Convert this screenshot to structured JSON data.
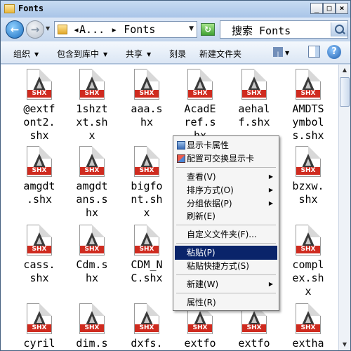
{
  "window": {
    "title": "Fonts",
    "min": "_",
    "max": "□",
    "close": "×"
  },
  "address": {
    "path": "◂A... ▸ Fonts",
    "search": "搜索 Fonts"
  },
  "toolbar": {
    "organize": "组织",
    "include_library": "包含到库中",
    "share": "共享",
    "burn": "刻录",
    "new_folder": "新建文件夹"
  },
  "files": [
    "@extf\nont2.\nshx",
    "1shzt\nxt.sh\nx",
    "aaa.s\nhx",
    "AcadE\nref.s\nhx",
    "aehal\nf.shx",
    "AMDTS\nymbol\ns.shx",
    "amgdt\n.shx",
    "amgdt\nans.s\nhx",
    "bigfo\nnt.sh\nx",
    "",
    "",
    "bzxw.\nshx",
    "cass.\nshx",
    "Cdm.s\nhx",
    "CDM_N\nC.shx",
    "",
    "",
    "compl\nex.sh\nx",
    "cyril",
    "dim.s",
    "dxfs.",
    "extfo",
    "extfo",
    "extha"
  ],
  "file_badge": "SHX",
  "context_menu": {
    "display_props": "显示卡属性",
    "switchable_display": "配置可交换显示卡",
    "view": "查看(V)",
    "sort_by": "排序方式(O)",
    "group_by": "分组依据(P)",
    "refresh": "刷新(E)",
    "customize_folder": "自定义文件夹(F)...",
    "paste": "粘贴(P)",
    "paste_shortcut": "粘贴快捷方式(S)",
    "new": "新建(W)",
    "properties": "属性(R)"
  }
}
